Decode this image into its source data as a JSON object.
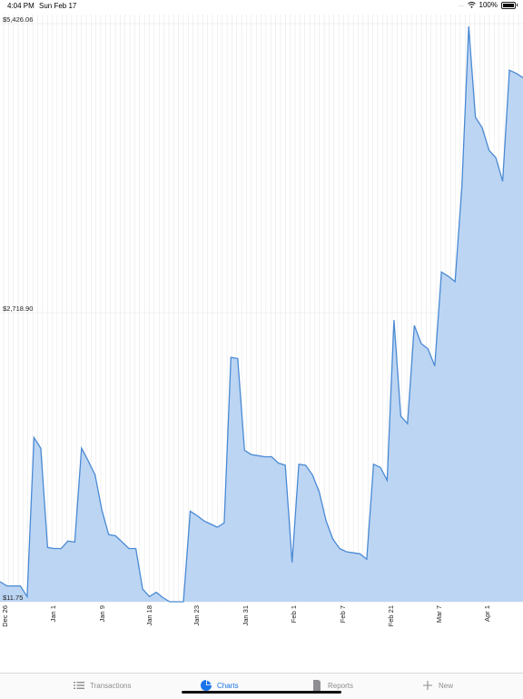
{
  "status_bar": {
    "time": "4:04 PM",
    "date": "Sun Feb 17",
    "signal": "....",
    "battery_text": "100%",
    "battery_level": 1.0
  },
  "tabs": [
    {
      "label": "Transactions",
      "icon": "list-icon",
      "active": false
    },
    {
      "label": "Charts",
      "icon": "pie-chart-icon",
      "active": true
    },
    {
      "label": "Reports",
      "icon": "document-icon",
      "active": false
    },
    {
      "label": "New",
      "icon": "plus-icon",
      "active": false
    }
  ],
  "colors": {
    "accent": "#1a73e8",
    "area_fill": "#b8d3f2",
    "area_stroke": "#4a8ad4",
    "grid": "#e3e3e3"
  },
  "chart_data": {
    "type": "area",
    "y_tick_labels": [
      "$5,426.06",
      "$2,718.90",
      "$11.75"
    ],
    "ylim": [
      11.75,
      5426.06
    ],
    "x_tick_labels": [
      "Dec 26",
      "Jan 1",
      "Jan 9",
      "Jan 18",
      "Jan 23",
      "Jan 31",
      "Feb 1",
      "Feb 7",
      "Feb 21",
      "Mar 7",
      "Apr 1"
    ],
    "grid": true,
    "values": [
      200,
      160,
      160,
      160,
      60,
      1550,
      1450,
      520,
      510,
      510,
      580,
      570,
      1450,
      1330,
      1200,
      870,
      640,
      630,
      570,
      510,
      510,
      130,
      60,
      100,
      50,
      0,
      -30,
      0,
      860,
      820,
      770,
      740,
      710,
      750,
      2300,
      2290,
      1430,
      1390,
      1380,
      1370,
      1370,
      1310,
      1290,
      380,
      1300,
      1290,
      1200,
      1040,
      770,
      600,
      510,
      480,
      470,
      460,
      410,
      1300,
      1270,
      1150,
      2650,
      1750,
      1680,
      2600,
      2430,
      2380,
      2220,
      3100,
      3060,
      3010,
      3900,
      5400,
      4550,
      4450,
      4240,
      4170,
      3950,
      4990,
      4960,
      4920
    ]
  }
}
